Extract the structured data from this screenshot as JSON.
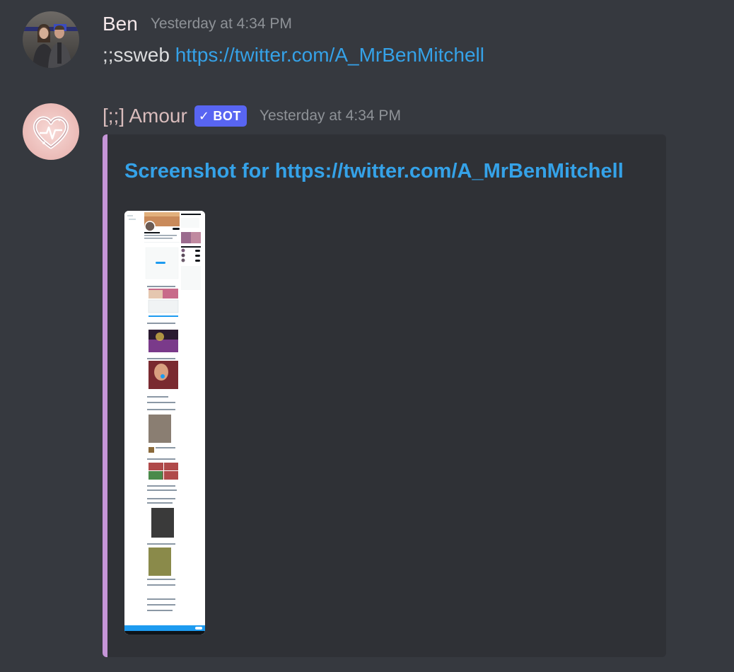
{
  "messages": [
    {
      "username": "Ben",
      "timestamp": "Yesterday at 4:34 PM",
      "content_prefix": ";;ssweb ",
      "content_link": "https://twitter.com/A_MrBenMitchell"
    },
    {
      "username": "[;;] Amour",
      "bot_tag": "BOT",
      "timestamp": "Yesterday at 4:34 PM",
      "embed": {
        "title": "Screenshot for https://twitter.com/A_MrBenMitchell",
        "accent_color": "#c595d7",
        "image_alt": "screenshot"
      }
    }
  ],
  "colors": {
    "background": "#36393f",
    "embed_background": "#2f3136",
    "link": "#35a2e8",
    "timestamp": "#8e9297",
    "bot_tag": "#5865f2"
  }
}
